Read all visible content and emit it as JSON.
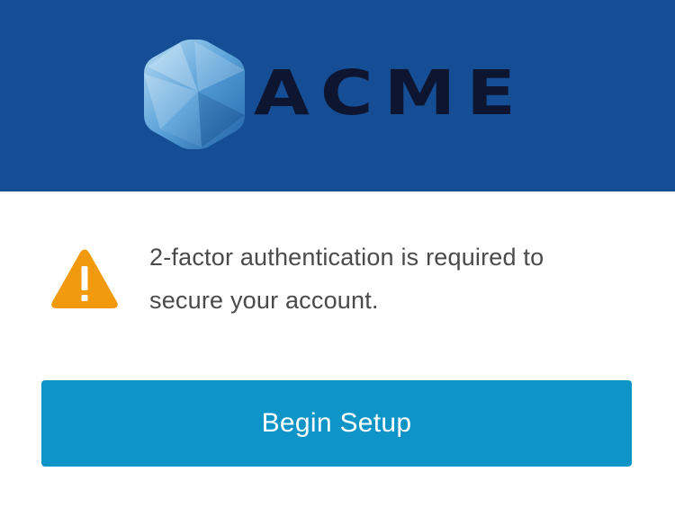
{
  "header": {
    "logo_text": "ACME",
    "logo_icon": "hexagon-logo-icon",
    "background_color": "#154e95"
  },
  "alert": {
    "icon": "warning-icon",
    "icon_color": "#f29a0e",
    "message": "2-factor authentication is required to secure your account."
  },
  "actions": {
    "begin_setup_label": "Begin Setup",
    "button_color": "#0f94c7"
  }
}
